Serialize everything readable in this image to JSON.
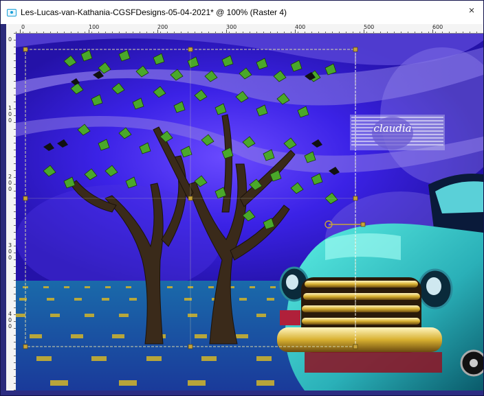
{
  "window": {
    "title": "Les-Lucas-van-Kathania-CGSFDesigns-05-04-2021* @ 100% (Raster 4)",
    "close_label": "×"
  },
  "ruler_h": {
    "labels": [
      "0",
      "100",
      "200",
      "300",
      "400",
      "500",
      "600"
    ]
  },
  "ruler_v": {
    "labels": [
      "0",
      "100",
      "200",
      "300",
      "400"
    ]
  },
  "watermark": {
    "text": "claudia"
  },
  "colors": {
    "sky": "#3b22e6",
    "ground": "#1e5aa8",
    "selection": "#c9a43a"
  }
}
